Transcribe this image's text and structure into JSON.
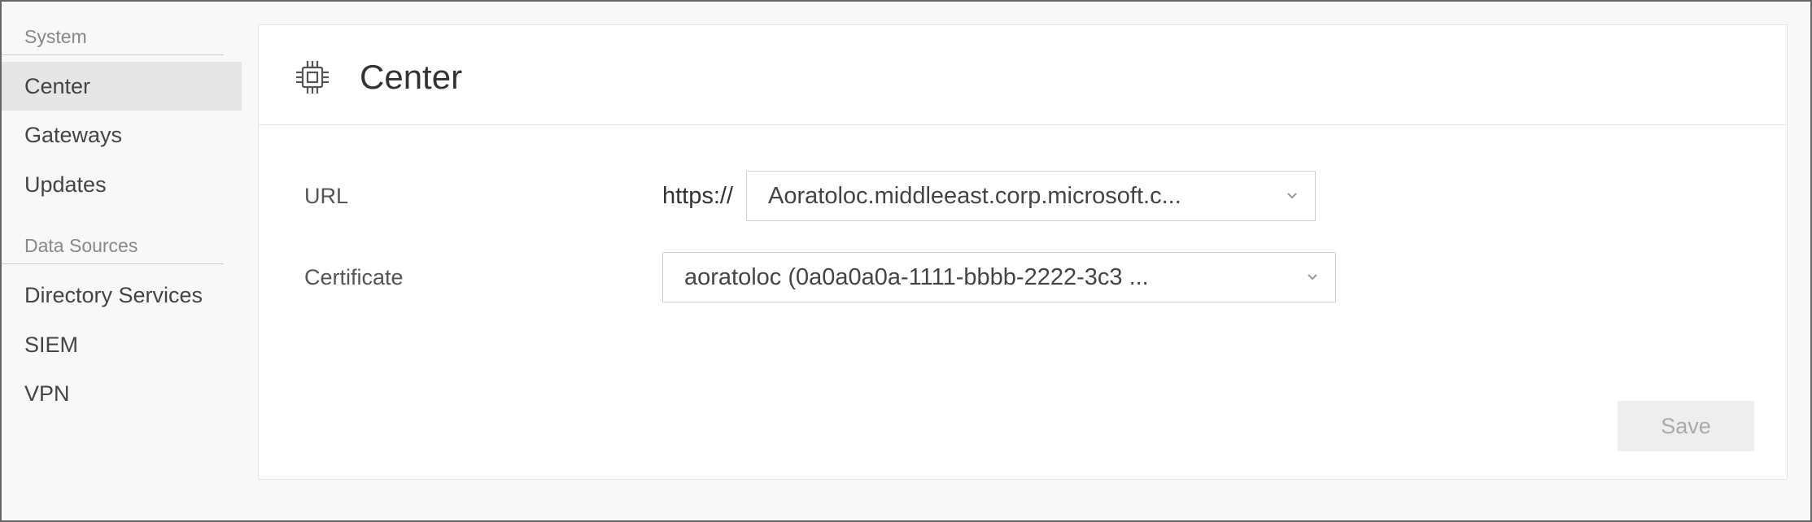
{
  "sidebar": {
    "sections": [
      {
        "header": "System",
        "items": [
          {
            "label": "Center",
            "active": true
          },
          {
            "label": "Gateways",
            "active": false
          },
          {
            "label": "Updates",
            "active": false
          }
        ]
      },
      {
        "header": "Data Sources",
        "items": [
          {
            "label": "Directory Services",
            "active": false
          },
          {
            "label": "SIEM",
            "active": false
          },
          {
            "label": "VPN",
            "active": false
          }
        ]
      }
    ]
  },
  "page": {
    "title": "Center",
    "icon": "chip-icon"
  },
  "form": {
    "url": {
      "label": "URL",
      "prefix": "https://",
      "value": "Aoratoloc.middleeast.corp.microsoft.c..."
    },
    "certificate": {
      "label": "Certificate",
      "value": "aoratoloc (0a0a0a0a-1111-bbbb-2222-3c3 ..."
    }
  },
  "actions": {
    "save_label": "Save"
  }
}
